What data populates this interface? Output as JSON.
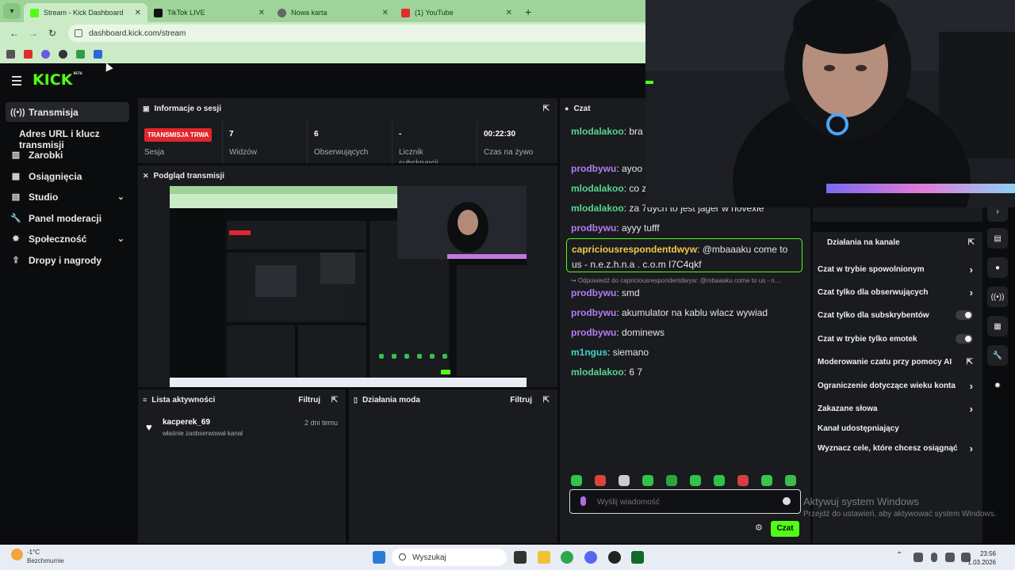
{
  "browser": {
    "tabs": [
      {
        "label": "Stream - Kick Dashboard",
        "color": "#53fc18"
      },
      {
        "label": "TikTok LIVE",
        "color": "#111111"
      },
      {
        "label": "Nowa karta",
        "color": "#5f6b5e"
      },
      {
        "label": "(1) YouTube",
        "color": "#e22b2b"
      }
    ],
    "url": "dashboard.kick.com/stream",
    "bookmark_colors": [
      "#555555",
      "#e22b2b",
      "#6a5ae0",
      "#333333",
      "#2f9d47",
      "#2a6ad8"
    ]
  },
  "kick": {
    "logo": "KICK",
    "logo_badge": "BETA"
  },
  "sidebar": {
    "items": [
      {
        "label": "Transmisja",
        "icon": "broadcast-icon"
      },
      {
        "label": "Adres URL i klucz transmisji"
      },
      {
        "label": "Zarobki",
        "icon": "earnings-icon"
      },
      {
        "label": "Osiągnięcia",
        "icon": "achievements-icon"
      },
      {
        "label": "Studio",
        "icon": "studio-icon"
      },
      {
        "label": "Panel moderacji",
        "icon": "wrench-icon"
      },
      {
        "label": "Społeczność",
        "icon": "community-icon"
      },
      {
        "label": "Dropy i nagrody",
        "icon": "drops-icon"
      }
    ]
  },
  "session": {
    "title": "Informacje o sesji",
    "live_badge": "TRANSMISJA TRWA",
    "session_label": "Sesja",
    "stats": [
      {
        "value": "7",
        "label": "Widzów"
      },
      {
        "value": "6",
        "label": "Obserwujących"
      },
      {
        "value": "-",
        "label": "Licznik subskrypcji"
      },
      {
        "value": "00:22:30",
        "label": "Czas na żywo"
      }
    ]
  },
  "preview": {
    "title": "Podgląd transmisji"
  },
  "activity": {
    "title": "Lista aktywności",
    "filter": "Filtruj",
    "items": [
      {
        "user": "kacperek_69",
        "action": "właśnie zaobserwował kanał",
        "time": "2 dni temu"
      }
    ]
  },
  "mod_actions": {
    "title": "Działania moda",
    "filter": "Filtruj"
  },
  "chat": {
    "title": "Czat",
    "messages": [
      {
        "user": "mlodalakoo",
        "color": "#58d68d",
        "text": "bra"
      },
      {
        "user": "prodbywu",
        "color": "#b57cf2",
        "text": "ayoo"
      },
      {
        "user": "mlodalakoo",
        "color": "#58d68d",
        "text": "co z"
      },
      {
        "user": "mlodalakoo",
        "color": "#58d68d",
        "text": "za 7dych to jest jager w novexie"
      },
      {
        "user": "prodbywu",
        "color": "#b57cf2",
        "text": "ayyy tufff"
      },
      {
        "user": "capriciousrespondentdwyw",
        "color": "#f2c94c",
        "text": "@mbaaaku come to us - n.e.z.h.n.a . c.o.m I7C4qkf"
      },
      {
        "user": "prodbywu",
        "color": "#b57cf2",
        "text": "smd"
      },
      {
        "user": "prodbywu",
        "color": "#b57cf2",
        "text": "akumulator na kablu wlacz wywiad"
      },
      {
        "user": "prodbywu",
        "color": "#b57cf2",
        "text": "dominews"
      },
      {
        "user": "m1ngus",
        "color": "#3fd8c8",
        "text": "siemano"
      },
      {
        "user": "mlodalakoo",
        "color": "#58d68d",
        "text": "6 7"
      }
    ],
    "reply_note": "↪ Odpowiedź do capriciousrespondentdwyw: @mbaaaku come to us - n....",
    "placeholder": "Wyślij wiadomość",
    "send_label": "Czat",
    "emote_colors": [
      "#33c24d",
      "#e0433a",
      "#cccccc",
      "#33c24d",
      "#2aa545",
      "#33c24d",
      "#2fc24a",
      "#d44040",
      "#38c44e",
      "#3fb94b"
    ]
  },
  "channel_actions": {
    "title": "Działania na kanale",
    "items": [
      {
        "label": "Czat w trybie spowolnionym",
        "control": "arrow"
      },
      {
        "label": "Czat tylko dla obserwujących",
        "control": "arrow"
      },
      {
        "label": "Czat tylko dla subskrybentów",
        "control": "toggle"
      },
      {
        "label": "Czat w trybie tylko emotek",
        "control": "toggle"
      },
      {
        "label": "Moderowanie czatu przy pomocy AI",
        "control": "external"
      },
      {
        "label": "Ograniczenie dotyczące wieku konta",
        "control": "arrow"
      },
      {
        "label": "Zakazane słowa",
        "control": "arrow"
      },
      {
        "label": "Kanał udostępniający",
        "control": "none"
      },
      {
        "label": "Wyznacz cele, które chcesz osiągnąć",
        "control": "arrow"
      }
    ]
  },
  "windows": {
    "watermark_title": "Aktywuj system Windows",
    "watermark_sub": "Przejdź do ustawień, aby aktywować system Windows.",
    "weather_temp": "-1°C",
    "weather_desc": "Bezchmurnie",
    "search": "Wyszukaj",
    "time": "23:56",
    "date": "1.03.2026"
  }
}
